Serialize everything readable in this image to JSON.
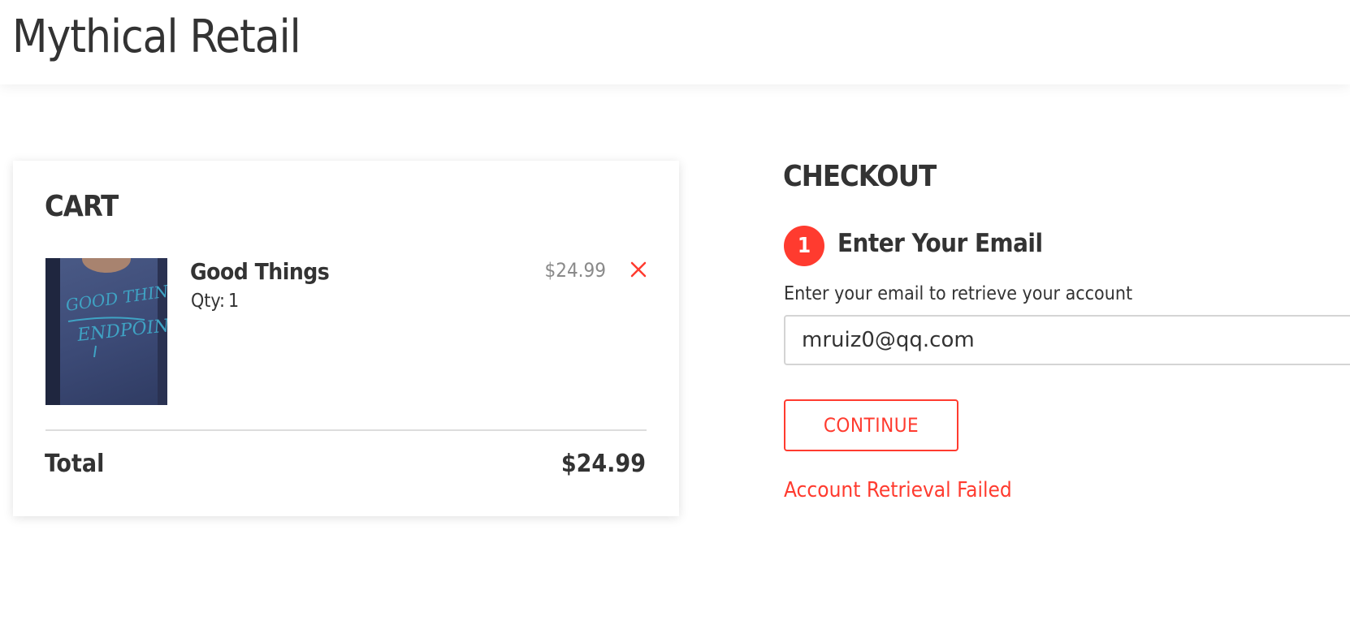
{
  "header": {
    "brand": "Mythical Retail"
  },
  "cart": {
    "title": "CART",
    "items": [
      {
        "name": "Good Things",
        "qty_label": "Qty:",
        "qty": "1",
        "price": "$24.99",
        "remove_icon": "close-icon",
        "image_print_text": [
          "GOOD THINGS",
          "ENDPOINT"
        ]
      }
    ],
    "total_label": "Total",
    "total_value": "$24.99"
  },
  "checkout": {
    "title": "CHECKOUT",
    "step_number": "1",
    "step_title": "Enter Your Email",
    "email_label": "Enter your email to retrieve your account",
    "email_value": "mruiz0@qq.com",
    "continue_label": "CONTINUE",
    "error_message": "Account Retrieval Failed"
  },
  "colors": {
    "accent": "#ff3b2f",
    "text": "#333333",
    "muted": "#8a8a8a",
    "divider": "#dddddd",
    "input_border": "#d4d4d4"
  }
}
